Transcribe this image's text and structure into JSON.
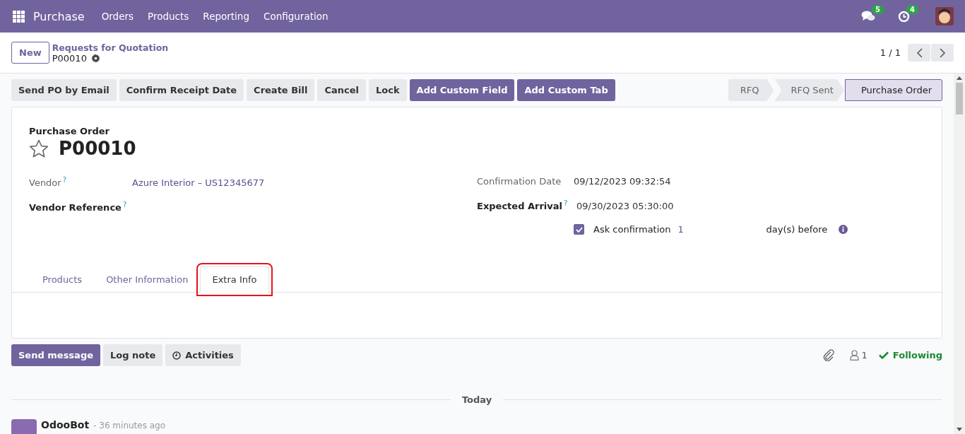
{
  "navbar": {
    "app_title": "Purchase",
    "menu": [
      "Orders",
      "Products",
      "Reporting",
      "Configuration"
    ],
    "messages_badge": "5",
    "activities_badge": "4"
  },
  "control_panel": {
    "new_button": "New",
    "breadcrumb_parent": "Requests for Quotation",
    "breadcrumb_current": "P00010",
    "pager": "1 / 1"
  },
  "action_buttons": [
    {
      "label": "Send PO by Email",
      "kind": "secondary"
    },
    {
      "label": "Confirm Receipt Date",
      "kind": "secondary"
    },
    {
      "label": "Create Bill",
      "kind": "secondary"
    },
    {
      "label": "Cancel",
      "kind": "secondary"
    },
    {
      "label": "Lock",
      "kind": "secondary"
    },
    {
      "label": "Add Custom Field",
      "kind": "primary"
    },
    {
      "label": "Add Custom Tab",
      "kind": "primary"
    }
  ],
  "status_bar": [
    {
      "label": "RFQ",
      "selected": false
    },
    {
      "label": "RFQ Sent",
      "selected": false
    },
    {
      "label": "Purchase Order",
      "selected": true
    }
  ],
  "form": {
    "title_label": "Purchase Order",
    "name": "P00010",
    "starred": false,
    "left_fields": [
      {
        "label": "Vendor",
        "help": "?",
        "value": "Azure Interior – US12345677",
        "bold": false
      },
      {
        "label": "Vendor Reference",
        "help": "?",
        "bold": true
      }
    ],
    "right_fields": [
      {
        "label": "Confirmation Date",
        "value": "09/12/2023 09:32:54",
        "bold": false
      },
      {
        "label": "Expected Arrival",
        "help": "?",
        "value": "09/30/2023 05:30:00",
        "bold": true
      }
    ],
    "ask_confirmation": {
      "checked": true,
      "label": "Ask confirmation",
      "value": "1",
      "suffix": "day(s) before"
    }
  },
  "tabs": [
    {
      "label": "Products",
      "selected": false,
      "highlighted": false
    },
    {
      "label": "Other Information",
      "selected": false,
      "highlighted": false
    },
    {
      "label": "Extra Info",
      "selected": true,
      "highlighted": true
    }
  ],
  "chatter": {
    "buttons": [
      {
        "label": "Send message",
        "kind": "primary"
      },
      {
        "label": "Log note",
        "kind": "secondary"
      },
      {
        "label": "Activities",
        "kind": "activities"
      }
    ],
    "followers_count": "1",
    "following": "Following",
    "date_separator": "Today",
    "message": {
      "author": "OdooBot",
      "time": "- 36 minutes ago"
    }
  }
}
